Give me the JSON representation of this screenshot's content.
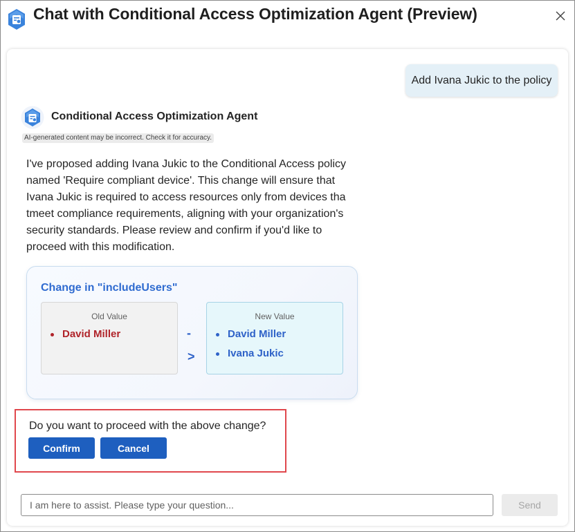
{
  "window": {
    "title": "Chat with Conditional Access Optimization Agent (Preview)",
    "close_icon": "close-icon",
    "app_icon": "agent-logo-icon"
  },
  "conversation": {
    "user_message": "Add Ivana Jukic to the policy",
    "agent": {
      "name": "Conditional Access Optimization Agent",
      "icon": "agent-logo-icon",
      "disclaimer": "AI-generated content may be incorrect. Check it for accuracy.",
      "message": "I've proposed adding Ivana Jukic to the Conditional Access policy named 'Require compliant device'. This change will ensure that Ivana Jukic is required to access resources only from devices tha tmeet compliance requirements, aligning with your organization's security standards. Please review and confirm if you'd like to proceed with this modification."
    },
    "change_card": {
      "title": "Change in \"includeUsers\"",
      "old_label": "Old Value",
      "old_values": [
        "David Miller"
      ],
      "arrow_dash": "-",
      "arrow_head": ">",
      "new_label": "New Value",
      "new_values": [
        "David Miller",
        "Ivana Jukic"
      ],
      "colors": {
        "old": "#b0242a",
        "new": "#2e62c8"
      }
    },
    "confirmation": {
      "question": "Do you want to proceed with the above change?",
      "confirm_label": "Confirm",
      "cancel_label": "Cancel",
      "highlight_color": "#e0474c"
    }
  },
  "composer": {
    "placeholder": "I am here to assist. Please type your question...",
    "send_label": "Send"
  },
  "colors": {
    "accent": "#1e5fbf",
    "user_bubble": "#e4f0f7"
  }
}
